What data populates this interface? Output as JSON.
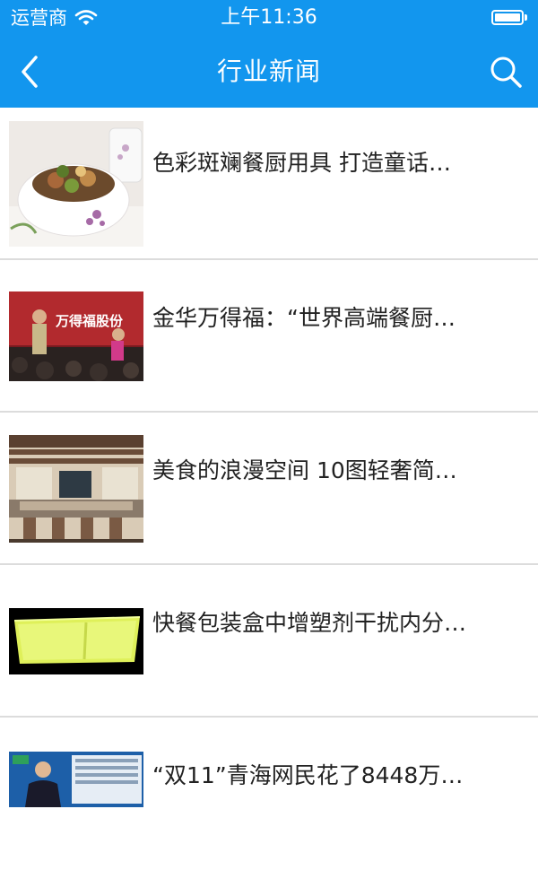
{
  "status_bar": {
    "carrier": "运营商",
    "time": "上午11:36",
    "wifi_icon": "wifi-icon",
    "battery_icon": "battery-icon",
    "battery_level": 1.0
  },
  "nav_bar": {
    "title": "行业新闻",
    "back_icon": "chevron-left-icon",
    "search_icon": "search-icon",
    "background": "#1296ee"
  },
  "news": [
    {
      "title": "色彩斑斓餐厨用具 打造童话…",
      "thumb_text": ""
    },
    {
      "title": "金华万得福：“世界高端餐厨…",
      "thumb_text": "万得福股份"
    },
    {
      "title": "美食的浪漫空间 10图轻奢简…",
      "thumb_text": ""
    },
    {
      "title": "快餐包装盒中增塑剂干扰内分…",
      "thumb_text": ""
    },
    {
      "title": "“双11”青海网民花了8448万…",
      "thumb_text": ""
    }
  ]
}
